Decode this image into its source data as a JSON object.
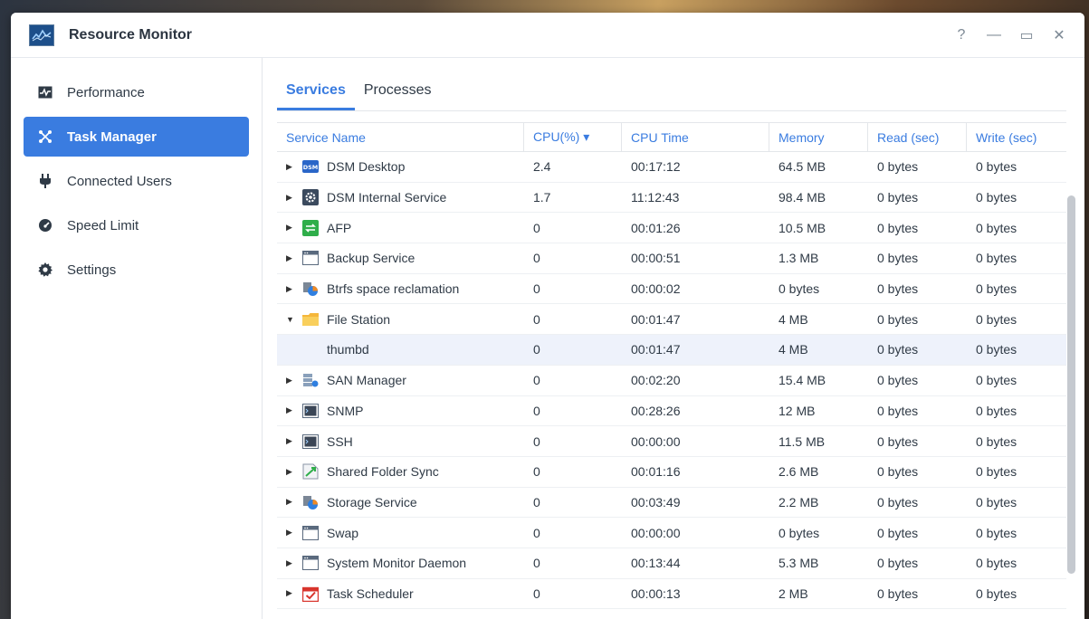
{
  "window": {
    "title": "Resource Monitor"
  },
  "window_controls": {
    "help": "?",
    "minimize": "—",
    "maximize": "▭",
    "close": "✕"
  },
  "sidebar": {
    "items": [
      {
        "label": "Performance",
        "icon": "performance-icon",
        "active": false
      },
      {
        "label": "Task Manager",
        "icon": "task-manager-icon",
        "active": true
      },
      {
        "label": "Connected Users",
        "icon": "plug-icon",
        "active": false
      },
      {
        "label": "Speed Limit",
        "icon": "speedometer-icon",
        "active": false
      },
      {
        "label": "Settings",
        "icon": "gear-icon",
        "active": false
      }
    ]
  },
  "tabs": [
    {
      "label": "Services",
      "active": true
    },
    {
      "label": "Processes",
      "active": false
    }
  ],
  "table": {
    "columns": [
      "Service Name",
      "CPU(%) ▾",
      "CPU Time",
      "Memory",
      "Read (sec)",
      "Write (sec)"
    ],
    "rows": [
      {
        "name": "DSM Desktop",
        "icon": "dsm-icon",
        "expand": "collapsed",
        "cpu": "2.4",
        "time": "00:17:12",
        "mem": "64.5 MB",
        "read": "0 bytes",
        "write": "0 bytes"
      },
      {
        "name": "DSM Internal Service",
        "icon": "gear-box-icon",
        "expand": "collapsed",
        "cpu": "1.7",
        "time": "11:12:43",
        "mem": "98.4 MB",
        "read": "0 bytes",
        "write": "0 bytes"
      },
      {
        "name": "AFP",
        "icon": "afp-icon",
        "expand": "collapsed",
        "cpu": "0",
        "time": "00:01:26",
        "mem": "10.5 MB",
        "read": "0 bytes",
        "write": "0 bytes"
      },
      {
        "name": "Backup Service",
        "icon": "window-icon",
        "expand": "collapsed",
        "cpu": "0",
        "time": "00:00:51",
        "mem": "1.3 MB",
        "read": "0 bytes",
        "write": "0 bytes"
      },
      {
        "name": "Btrfs space reclamation",
        "icon": "storage-icon",
        "expand": "collapsed",
        "cpu": "0",
        "time": "00:00:02",
        "mem": "0 bytes",
        "read": "0 bytes",
        "write": "0 bytes"
      },
      {
        "name": "File Station",
        "icon": "folder-icon",
        "expand": "expanded",
        "cpu": "0",
        "time": "00:01:47",
        "mem": "4 MB",
        "read": "0 bytes",
        "write": "0 bytes"
      },
      {
        "name": "thumbd",
        "icon": "",
        "expand": "child",
        "cpu": "0",
        "time": "00:01:47",
        "mem": "4 MB",
        "read": "0 bytes",
        "write": "0 bytes"
      },
      {
        "name": "SAN Manager",
        "icon": "san-icon",
        "expand": "collapsed",
        "cpu": "0",
        "time": "00:02:20",
        "mem": "15.4 MB",
        "read": "0 bytes",
        "write": "0 bytes"
      },
      {
        "name": "SNMP",
        "icon": "terminal-icon",
        "expand": "collapsed",
        "cpu": "0",
        "time": "00:28:26",
        "mem": "12 MB",
        "read": "0 bytes",
        "write": "0 bytes"
      },
      {
        "name": "SSH",
        "icon": "terminal-icon",
        "expand": "collapsed",
        "cpu": "0",
        "time": "00:00:00",
        "mem": "11.5 MB",
        "read": "0 bytes",
        "write": "0 bytes"
      },
      {
        "name": "Shared Folder Sync",
        "icon": "sync-icon",
        "expand": "collapsed",
        "cpu": "0",
        "time": "00:01:16",
        "mem": "2.6 MB",
        "read": "0 bytes",
        "write": "0 bytes"
      },
      {
        "name": "Storage Service",
        "icon": "storage-icon",
        "expand": "collapsed",
        "cpu": "0",
        "time": "00:03:49",
        "mem": "2.2 MB",
        "read": "0 bytes",
        "write": "0 bytes"
      },
      {
        "name": "Swap",
        "icon": "window-icon",
        "expand": "collapsed",
        "cpu": "0",
        "time": "00:00:00",
        "mem": "0 bytes",
        "read": "0 bytes",
        "write": "0 bytes"
      },
      {
        "name": "System Monitor Daemon",
        "icon": "window-icon",
        "expand": "collapsed",
        "cpu": "0",
        "time": "00:13:44",
        "mem": "5.3 MB",
        "read": "0 bytes",
        "write": "0 bytes"
      },
      {
        "name": "Task Scheduler",
        "icon": "calendar-check-icon",
        "expand": "collapsed",
        "cpu": "0",
        "time": "00:00:13",
        "mem": "2 MB",
        "read": "0 bytes",
        "write": "0 bytes"
      }
    ]
  },
  "colors": {
    "accent": "#3a7ce0",
    "selected_row": "#eef2fb"
  }
}
